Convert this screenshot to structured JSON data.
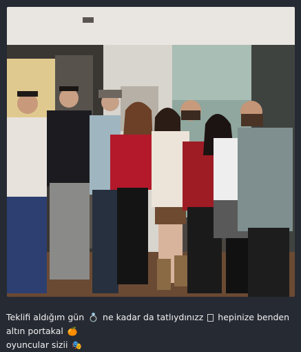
{
  "post": {
    "caption_part1": "Teklifi aldığım gün",
    "caption_part2": "ne kadar da tatlıydınızz",
    "caption_part3": "hepinize benden altın portakal",
    "caption_part4": "oyuncular sizii",
    "emoji_1": "💍",
    "emoji_2": "🍊",
    "emoji_3": "🎭"
  },
  "icons": {
    "ring": "ring-emoji-icon",
    "missing_glyph": "missing-glyph-icon",
    "orange": "orange-emoji-icon",
    "theater": "theater-masks-emoji-icon"
  }
}
